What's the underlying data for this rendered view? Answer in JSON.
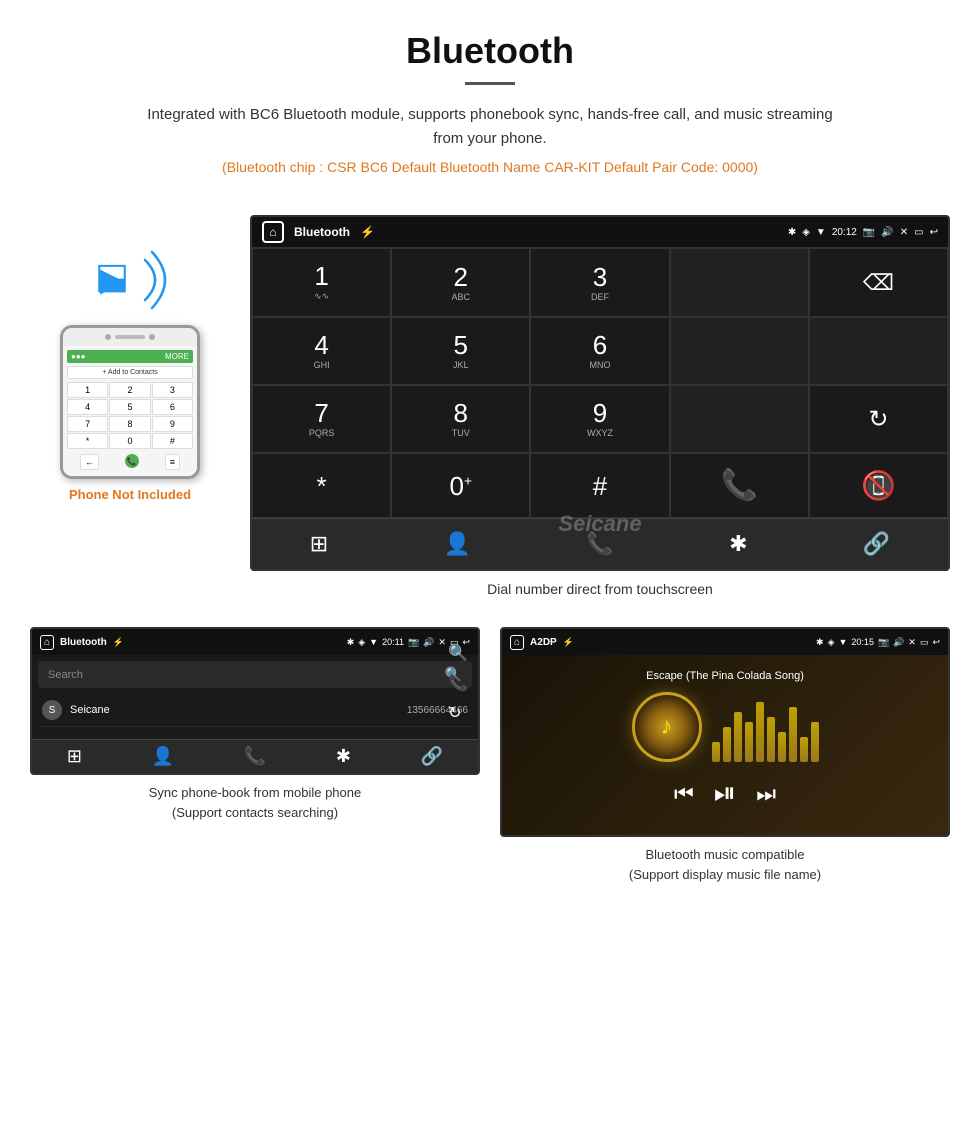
{
  "header": {
    "title": "Bluetooth",
    "description": "Integrated with BC6 Bluetooth module, supports phonebook sync, hands-free call, and music streaming from your phone.",
    "specs": "(Bluetooth chip : CSR BC6    Default Bluetooth Name CAR-KIT    Default Pair Code: 0000)"
  },
  "phone_section": {
    "not_included_label": "Phone Not Included"
  },
  "dial_screen": {
    "status_title": "Bluetooth",
    "time": "20:12",
    "caption": "Dial number direct from touchscreen",
    "keys": [
      {
        "num": "1",
        "letters": "∽∽"
      },
      {
        "num": "2",
        "letters": "ABC"
      },
      {
        "num": "3",
        "letters": "DEF"
      },
      {
        "num": "",
        "letters": ""
      },
      {
        "num": "",
        "letters": "backspace"
      },
      {
        "num": "4",
        "letters": "GHI"
      },
      {
        "num": "5",
        "letters": "JKL"
      },
      {
        "num": "6",
        "letters": "MNO"
      },
      {
        "num": "",
        "letters": ""
      },
      {
        "num": "",
        "letters": ""
      },
      {
        "num": "7",
        "letters": "PQRS"
      },
      {
        "num": "8",
        "letters": "TUV"
      },
      {
        "num": "9",
        "letters": "WXYZ"
      },
      {
        "num": "",
        "letters": ""
      },
      {
        "num": "",
        "letters": "refresh"
      },
      {
        "num": "*",
        "letters": ""
      },
      {
        "num": "0",
        "letters": "+"
      },
      {
        "num": "#",
        "letters": ""
      },
      {
        "num": "",
        "letters": "call_green"
      },
      {
        "num": "",
        "letters": "call_red"
      }
    ]
  },
  "phonebook_screen": {
    "status_title": "Bluetooth",
    "time": "20:11",
    "search_placeholder": "Search",
    "contacts": [
      {
        "initial": "S",
        "name": "Seicane",
        "number": "13566664466"
      }
    ],
    "caption_line1": "Sync phone-book from mobile phone",
    "caption_line2": "(Support contacts searching)"
  },
  "music_screen": {
    "status_title": "A2DP",
    "time": "20:15",
    "song_title": "Escape (The Pina Colada Song)",
    "caption_line1": "Bluetooth music compatible",
    "caption_line2": "(Support display music file name)"
  },
  "brand": {
    "name": "Seicane"
  }
}
